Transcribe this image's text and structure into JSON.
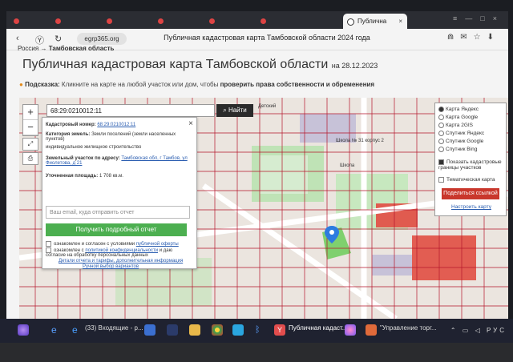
{
  "browser": {
    "tabs": [
      {
        "label": ""
      },
      {
        "label": ""
      },
      {
        "label": ""
      },
      {
        "label": ""
      },
      {
        "label": ""
      },
      {
        "label": ""
      },
      {
        "label": "Публична",
        "active": true
      }
    ],
    "url": "egrp365.org",
    "page_title": "Публичная кадастровая карта Тамбовской области 2024 года"
  },
  "breadcrumb": {
    "home": "Россия",
    "arrow": "→",
    "current": "Тамбовская область"
  },
  "header": {
    "title": "Публичная кадастровая карта Тамбовской области",
    "date": "на 28.12.2023"
  },
  "hint": {
    "label": "Подсказка:",
    "text": "Кликните на карте на любой участок или дом, чтобы",
    "strong": "проверить права собственности и обременения"
  },
  "map": {
    "zoom_in": "+",
    "zoom_out": "−",
    "search_value": "68:29:0210012:11",
    "search_button": "Найти",
    "labels": {
      "school": "Школа № 31 корпус 2",
      "school2": "Школа",
      "street": "Детский"
    }
  },
  "popup": {
    "cad_label": "Кадастровый номер:",
    "cad_value": "68:29:0210012:11",
    "cat_label": "Категория земель:",
    "cat_value": "Земли поселений (земли населенных пунктов)",
    "use_value": "индивидуальное жилищное строительство",
    "addr_label": "Земельный участок по адресу:",
    "addr_value": "Тамбовская обл, г Тамбов, ул Фиолетова, д 21",
    "area_label": "Уточненная площадь:",
    "area_value": "1 708 кв.м.",
    "email_placeholder": "Ваш email, куда отправить отчет",
    "button": "Получить подробный отчет",
    "agree1": "ознакомлен и согласен с условиями",
    "agree1_link": "публичной оферты",
    "agree2": "ознакомлен с",
    "agree2_link": "политикой конфиденциальности",
    "agree2b": "и даю согласие на обработку персональных данных",
    "details_link": "Детали отчета и тарифы, дополнительная информация",
    "choice_link": "Ручной выбор вариантов"
  },
  "layers": {
    "options": [
      "Карта Яндекс",
      "Карта Google",
      "Карта 2GIS",
      "Спутник Яндекс",
      "Спутник Google",
      "Спутник Bing"
    ],
    "selected": 0,
    "check1": "Показать кадастровые границы участков",
    "check2": "Тематическая карта",
    "share": "Поделиться ссылкой",
    "settings": "Настроить карту"
  },
  "taskbar": {
    "mail": "(33) Входящие - р...",
    "active_window": "Публичная кадаст...",
    "other_window": "\"Управление торг...",
    "lang": "РУС"
  },
  "colors": {
    "accent_green": "#4caf50",
    "share_red": "#c9372c",
    "parcel_line": "#b5162b",
    "map_green": "#8fd18a"
  }
}
